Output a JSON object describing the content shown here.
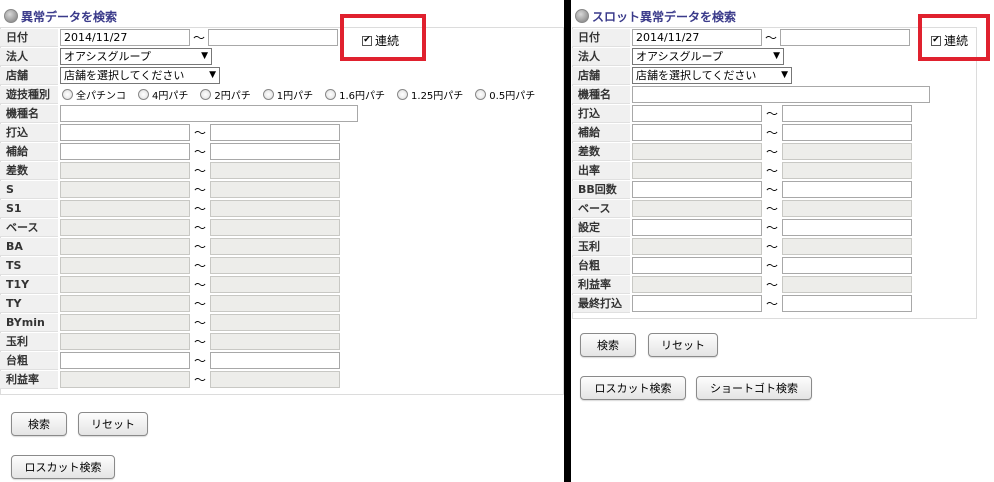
{
  "left": {
    "title": "異常データを検索",
    "date_label": "日付",
    "date_value": "2014/11/27",
    "date_tilde": "〜",
    "continuous_label": "連続",
    "continuous_checked": "✔",
    "corp_label": "法人",
    "corp_value": "オアシスグループ",
    "store_label": "店舗",
    "store_value": "店舗を選択してください",
    "game_label": "遊技種別",
    "game_options": [
      "全パチンコ",
      "4円パチ",
      "2円パチ",
      "1円パチ",
      "1.6円パチ",
      "1.25円パチ",
      "0.5円パチ"
    ],
    "model_label": "機種名",
    "tilde": "〜",
    "rows": [
      {
        "label": "打込",
        "readonly": false
      },
      {
        "label": "補給",
        "readonly": false
      },
      {
        "label": "差数",
        "readonly": true
      },
      {
        "label": "S",
        "readonly": true
      },
      {
        "label": "S1",
        "readonly": true
      },
      {
        "label": "ベース",
        "readonly": true
      },
      {
        "label": "BA",
        "readonly": true
      },
      {
        "label": "TS",
        "readonly": true
      },
      {
        "label": "T1Y",
        "readonly": true
      },
      {
        "label": "TY",
        "readonly": true
      },
      {
        "label": "BYmin",
        "readonly": true
      },
      {
        "label": "玉利",
        "readonly": true
      },
      {
        "label": "台粗",
        "readonly": false
      },
      {
        "label": "利益率",
        "readonly": true
      }
    ],
    "search_button": "検索",
    "reset_button": "リセット",
    "loss_cut_button": "ロスカット検索"
  },
  "right": {
    "title": "スロット異常データを検索",
    "date_label": "日付",
    "date_value": "2014/11/27",
    "date_tilde": "〜",
    "continuous_label": "連続",
    "continuous_checked": "✔",
    "corp_label": "法人",
    "corp_value": "オアシスグループ",
    "store_label": "店舗",
    "store_value": "店舗を選択してください",
    "model_label": "機種名",
    "tilde": "〜",
    "rows": [
      {
        "label": "打込",
        "readonly": false
      },
      {
        "label": "補給",
        "readonly": false
      },
      {
        "label": "差数",
        "readonly": true
      },
      {
        "label": "出率",
        "readonly": true
      },
      {
        "label": "BB回数",
        "readonly": false
      },
      {
        "label": "ベース",
        "readonly": true
      },
      {
        "label": "設定",
        "readonly": false
      },
      {
        "label": "玉利",
        "readonly": true
      },
      {
        "label": "台粗",
        "readonly": false
      },
      {
        "label": "利益率",
        "readonly": true
      },
      {
        "label": "最終打込",
        "readonly": false
      }
    ],
    "search_button": "検索",
    "reset_button": "リセット",
    "loss_cut_button": "ロスカット検索",
    "short_goto_button": "ショートゴト検索"
  },
  "colors": {
    "highlight_frame": "#e0212e",
    "title_text": "#3a3a8a",
    "label_bg": "#f0f0f0",
    "readonly_bg": "#ededea"
  }
}
